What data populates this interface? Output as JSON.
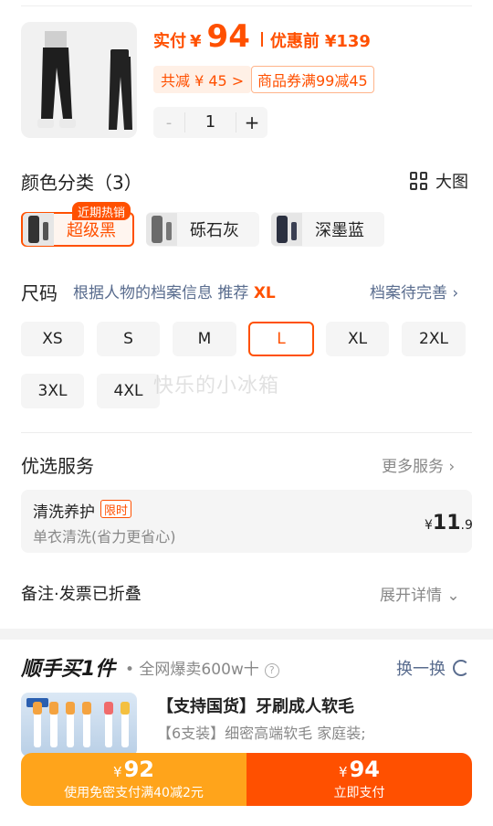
{
  "product": {
    "paid_label": "实付",
    "currency": "¥",
    "price": "94",
    "before_label": "优惠前",
    "before_price": "¥139",
    "total_saving": "共减 ¥ 45 >",
    "coupon": "商品券满99减45",
    "quantity": "1",
    "minus": "-",
    "plus": "+"
  },
  "color_section": {
    "title": "颜色分类（3）",
    "view_big": "大图",
    "hot_badge": "近期热销",
    "options": [
      "超级黑",
      "砾石灰",
      "深墨蓝"
    ]
  },
  "size_section": {
    "title": "尺码",
    "hint_prefix": "根据人物的档案信息 推荐",
    "hint_size": "XL",
    "profile_link": "档案待完善 ›",
    "options": [
      "XS",
      "S",
      "M",
      "L",
      "XL",
      "2XL",
      "3XL",
      "4XL"
    ],
    "selected": "L"
  },
  "watermark": "快乐的小冰箱",
  "services": {
    "title": "优选服务",
    "more": "更多服务 ›",
    "item_name": "清洗养护",
    "item_badge": "限时",
    "item_desc": "单衣清洗(省力更省心)",
    "price_currency": "¥",
    "price_int": "11",
    "price_dec": ".9"
  },
  "remark": {
    "label": "备注·发票已折叠",
    "expand": "展开详情 ⌄"
  },
  "buy_along": {
    "title": "顺手买1件",
    "subtitle": "• 全网爆卖600w十",
    "help": "?",
    "swap": "换一换",
    "product_name": "【支持国货】牙刷成人软毛",
    "product_desc": "【6支装】细密高端软毛 家庭装;"
  },
  "pay_bar": {
    "left_currency": "¥",
    "left_amount": "92",
    "left_sub": "使用免密支付满40减2元",
    "right_currency": "¥",
    "right_amount": "94",
    "right_sub": "立即支付"
  },
  "colors": {
    "accent": "#ff5000",
    "secondary": "#ffa41b",
    "link": "#596c8e"
  }
}
